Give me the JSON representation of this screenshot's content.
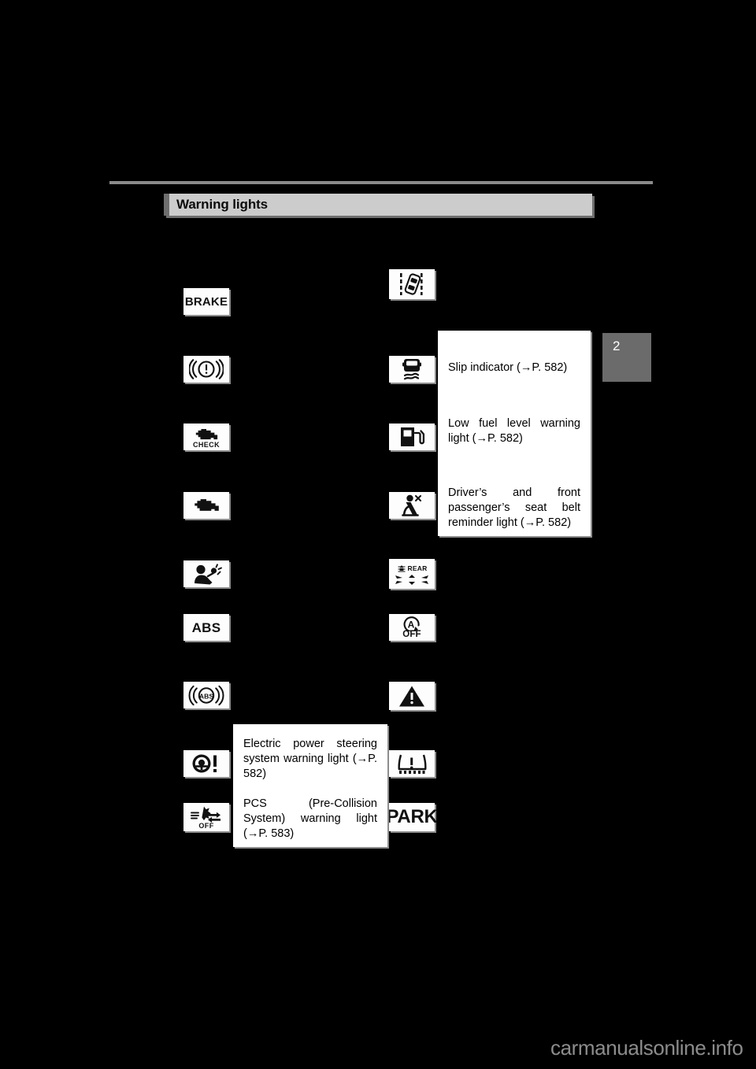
{
  "page": {
    "background_color": "#000000",
    "chapter_tab": {
      "number": "2",
      "color": "#6b6b6b"
    },
    "watermark": "carmanualsonline.info"
  },
  "header": {
    "title": "Warning lights",
    "banner_color": "#cccccc",
    "accent_color": "#6e6e6e"
  },
  "left_column": {
    "icons": [
      {
        "name": "brake-system-warning-light",
        "label": "BRAKE"
      },
      {
        "name": "brake-warning-circle-light",
        "label": ""
      },
      {
        "name": "check-engine-light",
        "label": "CHECK"
      },
      {
        "name": "engine-malfunction-light",
        "label": ""
      },
      {
        "name": "srs-airbag-warning-light",
        "label": ""
      },
      {
        "name": "abs-text-warning-light",
        "label": "ABS"
      },
      {
        "name": "abs-circle-warning-light",
        "label": "ABS"
      },
      {
        "name": "electric-power-steering-warning-light",
        "label": ""
      },
      {
        "name": "pcs-pre-collision-system-off-light",
        "label": "OFF"
      }
    ]
  },
  "right_column": {
    "icons": [
      {
        "name": "lane-departure-alert-light",
        "label": ""
      },
      {
        "name": "slip-indicator-light",
        "label": ""
      },
      {
        "name": "low-fuel-level-warning-light",
        "label": ""
      },
      {
        "name": "seat-belt-reminder-light",
        "label": ""
      },
      {
        "name": "rear-fog-light-indicator",
        "label": "REAR"
      },
      {
        "name": "auto-stop-start-off-light",
        "label": "OFF"
      },
      {
        "name": "master-warning-light",
        "label": ""
      },
      {
        "name": "tire-pressure-warning-light",
        "label": ""
      },
      {
        "name": "park-indicator-light",
        "label": "PARK"
      }
    ]
  },
  "right_descriptions": [
    {
      "text": "Slip indicator (→P. 582)"
    },
    {
      "text": "Low fuel level warning light (→P. 582)"
    },
    {
      "text": "Driver’s and front passenger’s seat belt reminder light (→P. 582)"
    }
  ],
  "left_descriptions": [
    {
      "text": "Electric power steering system warning light (→P. 582)"
    },
    {
      "text": "PCS (Pre-Collision System) warning light (→P. 583)"
    }
  ]
}
